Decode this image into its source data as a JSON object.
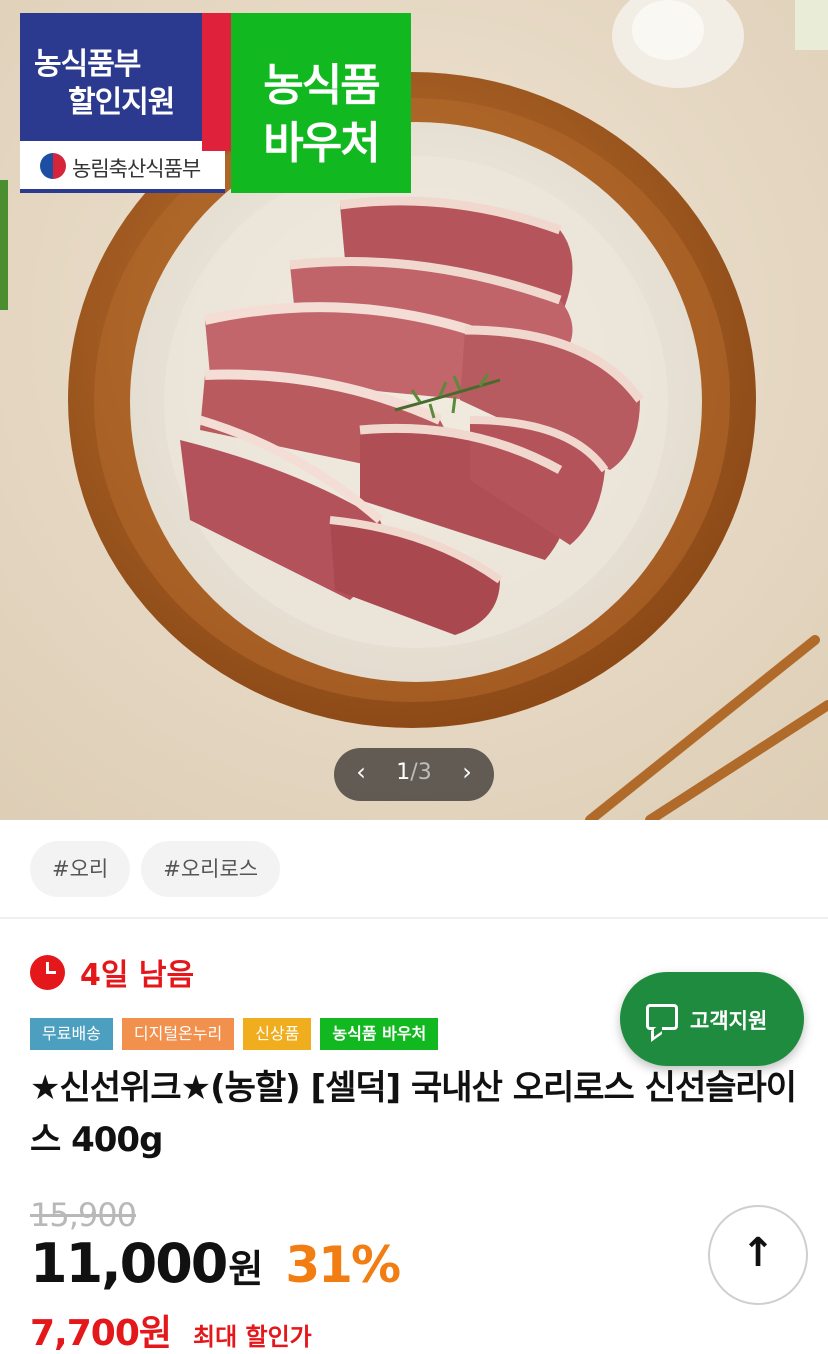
{
  "hero": {
    "badge_blue_line1": "농식품부",
    "badge_blue_line2": "할인지원",
    "ministry": "농림축산식품부",
    "badge_green_line1": "농식품",
    "badge_green_line2": "바우처",
    "pager": {
      "current": "1",
      "separator": "/",
      "total": "3",
      "prev_icon": "chevron-left-icon",
      "next_icon": "chevron-right-icon"
    }
  },
  "tags": [
    "#오리",
    "#오리로스"
  ],
  "timer": {
    "label": "4일 남음",
    "icon": "clock-icon",
    "color": "#e4171a"
  },
  "labels": [
    "무료배송",
    "디지털온누리",
    "신상품",
    "농식품 바우처"
  ],
  "support": {
    "label": "고객지원",
    "icon": "chat-icon",
    "color": "#1f8b3f"
  },
  "product": {
    "title": "★신선위크★(농할) [셀덕] 국내산 오리로스 신선슬라이스 400g",
    "original_price": "15,900",
    "price": "11,000",
    "price_unit": "원",
    "discount_rate": "31%",
    "max_discount_price": "7,700원",
    "max_discount_label": "최대 할인가"
  },
  "scroll_top": {
    "icon": "arrow-up-icon",
    "glyph": "↑"
  }
}
